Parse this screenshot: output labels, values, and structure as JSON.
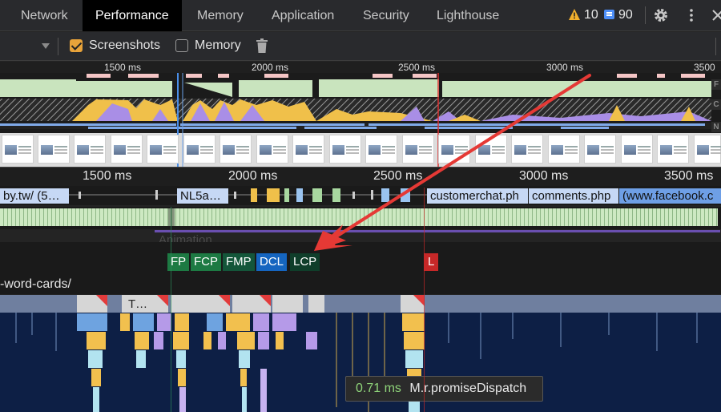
{
  "tabs": [
    {
      "label": "Network",
      "active": false
    },
    {
      "label": "Performance",
      "active": true
    },
    {
      "label": "Memory",
      "active": false
    },
    {
      "label": "Application",
      "active": false
    },
    {
      "label": "Security",
      "active": false
    },
    {
      "label": "Lighthouse",
      "active": false
    }
  ],
  "status": {
    "warnings": "10",
    "messages": "90",
    "warning_color": "#f2b02d",
    "message_color": "#4d8ef7"
  },
  "toolbar": {
    "screenshots": {
      "label": "Screenshots",
      "checked": true
    },
    "memory": {
      "label": "Memory",
      "checked": false
    }
  },
  "overview": {
    "ticks": [
      "1500 ms",
      "2000 ms",
      "2500 ms",
      "3000 ms",
      "3500"
    ],
    "track_labels": [
      "F",
      "C",
      "N"
    ]
  },
  "timeline": {
    "ticks": [
      "1500 ms",
      "2000 ms",
      "2500 ms",
      "3000 ms",
      "3500 ms"
    ],
    "network_items": [
      "by.tw/ (5…",
      "NL5a…",
      "customerchat.ph",
      "comments.php",
      "(www.facebook.c"
    ],
    "animation_label": "Animation",
    "markers": [
      {
        "label": "FP",
        "color": "#1d7a43"
      },
      {
        "label": "FCP",
        "color": "#1d7a43"
      },
      {
        "label": "FMP",
        "color": "#14563a"
      },
      {
        "label": "DCL",
        "color": "#1565c0"
      },
      {
        "label": "LCP",
        "color": "#0f3e2a"
      },
      {
        "label": "L",
        "color": "#c62828"
      }
    ],
    "url": "-word-cards/",
    "flame_task_label": "T…"
  },
  "tooltip": {
    "time": "0.71 ms",
    "name": "M.r.promiseDispatch"
  },
  "annotation": {
    "arrow_color": "#e53935"
  }
}
